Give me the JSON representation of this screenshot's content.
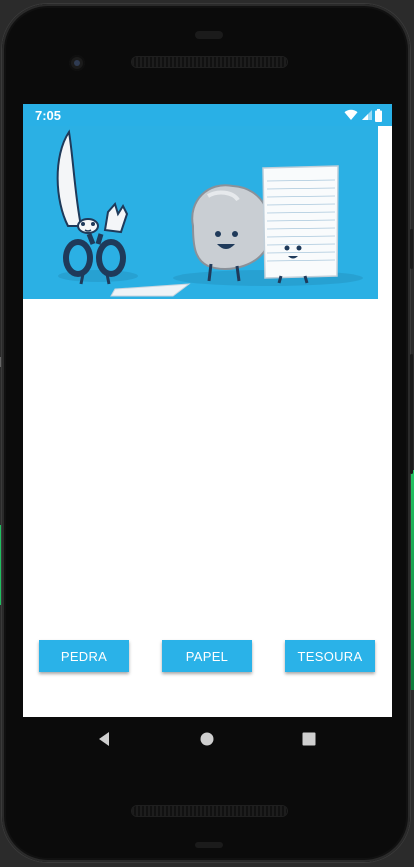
{
  "status_bar": {
    "time": "7:05",
    "icons": [
      "wifi-icon",
      "signal-icon",
      "battery-icon"
    ],
    "background": "#29b0e6"
  },
  "hero": {
    "description_icons": [
      "scissors-character-icon",
      "rock-character-icon",
      "paper-character-icon"
    ],
    "background": "#2bb0e4"
  },
  "actions": {
    "buttons": [
      "PEDRA",
      "PAPEL",
      "TESOURA"
    ],
    "color": "#2ab2e8"
  },
  "navigation": {
    "icons": [
      "back-icon",
      "home-icon",
      "recents-icon"
    ]
  }
}
